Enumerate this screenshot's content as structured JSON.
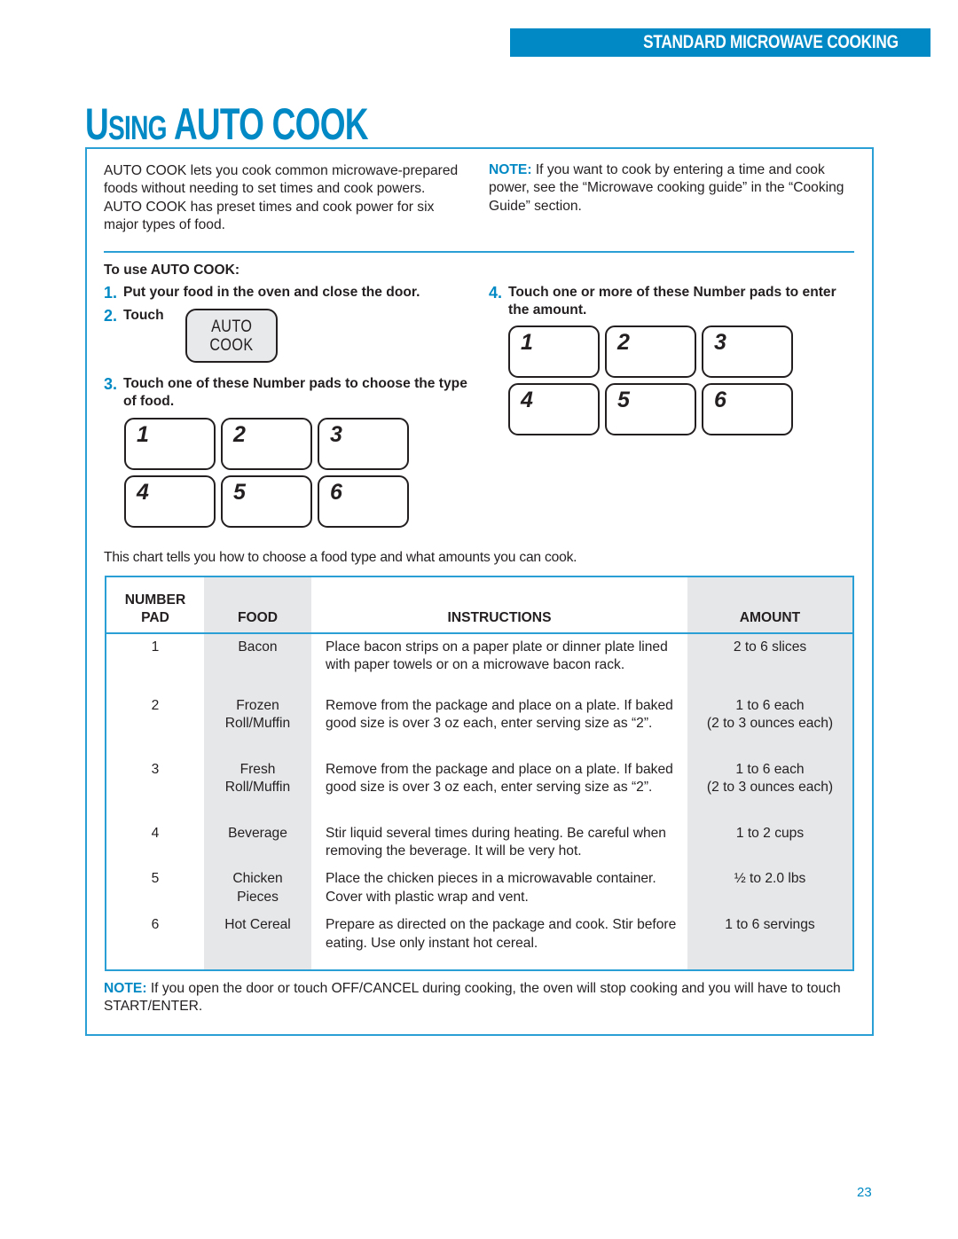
{
  "header": {
    "section_banner": "STANDARD MICROWAVE COOKING",
    "title_prefix_initial": "U",
    "title_prefix_rest": "SING",
    "title_main": "AUTO COOK"
  },
  "intro": {
    "left_text": "AUTO COOK lets you cook common microwave-prepared foods without needing to set times and cook powers. AUTO COOK has preset times and cook power for six major types of food.",
    "note_label": "NOTE:",
    "note_text": " If you want to cook by entering a time and cook power, see the “Microwave cooking guide” in the “Cooking Guide” section."
  },
  "steps": {
    "heading": "To use AUTO COOK:",
    "items": [
      {
        "num": "1.",
        "text": "Put your food in the oven and close the door."
      },
      {
        "num": "2.",
        "text": "Touch"
      },
      {
        "num": "3.",
        "text": "Touch one of these Number pads to choose the type of food."
      },
      {
        "num": "4.",
        "text": "Touch one or more of these Number pads to enter the amount."
      }
    ],
    "auto_cook_pad": {
      "line1": "AUTO",
      "line2": "COOK"
    },
    "food_pads": [
      "1",
      "2",
      "3",
      "4",
      "5",
      "6"
    ],
    "amount_pads": [
      "1",
      "2",
      "3",
      "4",
      "5",
      "6"
    ]
  },
  "chart_intro": "This chart tells you how to choose a food type and what amounts you can cook.",
  "table": {
    "headers": {
      "number_pad_line1": "NUMBER",
      "number_pad_line2": "PAD",
      "food": "FOOD",
      "instructions": "INSTRUCTIONS",
      "amount": "AMOUNT"
    },
    "rows": [
      {
        "pad": "1",
        "food_line1": "Bacon",
        "food_line2": "",
        "instructions": "Place bacon strips on a paper plate or dinner plate lined with paper towels or on a microwave bacon rack.",
        "amount_line1": "2 to 6 slices",
        "amount_line2": ""
      },
      {
        "pad": "2",
        "food_line1": "Frozen",
        "food_line2": "Roll/Muffin",
        "instructions": "Remove from the package and place on a plate. If baked good size is over 3 oz each, enter serving size as “2”.",
        "amount_line1": "1 to 6 each",
        "amount_line2": "(2 to 3 ounces each)"
      },
      {
        "pad": "3",
        "food_line1": "Fresh",
        "food_line2": "Roll/Muffin",
        "instructions": "Remove from the package and place on a plate. If baked good size is over 3 oz each, enter serving size as “2”.",
        "amount_line1": "1 to 6 each",
        "amount_line2": "(2 to 3 ounces each)"
      },
      {
        "pad": "4",
        "food_line1": "Beverage",
        "food_line2": "",
        "instructions": "Stir liquid several times during heating. Be careful when removing the beverage. It will be very hot.",
        "amount_line1": "1 to 2 cups",
        "amount_line2": ""
      },
      {
        "pad": "5",
        "food_line1": "Chicken",
        "food_line2": "Pieces",
        "instructions": "Place the chicken pieces in a microwavable container. Cover with plastic wrap and vent.",
        "amount_line1": "½ to 2.0 lbs",
        "amount_line2": ""
      },
      {
        "pad": "6",
        "food_line1": "Hot Cereal",
        "food_line2": "",
        "instructions": "Prepare as directed on the package and cook. Stir before eating. Use only instant hot cereal.",
        "amount_line1": "1 to 6 servings",
        "amount_line2": ""
      }
    ]
  },
  "bottom_note": {
    "label": "NOTE:",
    "text": " If you open the door or touch OFF/CANCEL during cooking, the oven will stop cooking and you will have to touch START/ENTER."
  },
  "page_number": "23",
  "colors": {
    "accent_blue": "#0089c4",
    "frame_blue": "#2a9fd6",
    "table_shade": "#e6e7e9",
    "pad_fill": "#e8e9eb"
  }
}
